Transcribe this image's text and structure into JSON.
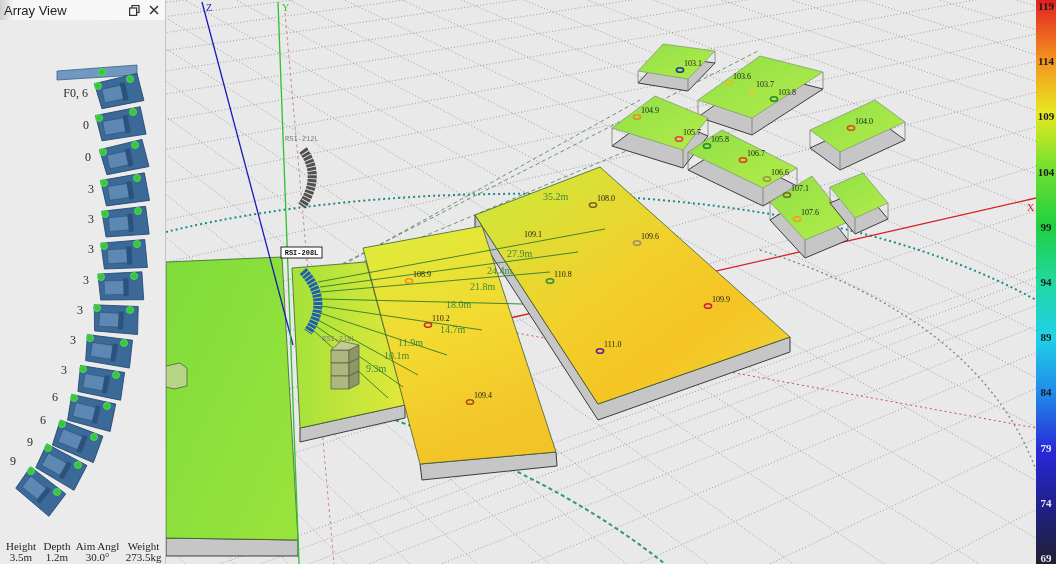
{
  "array_view": {
    "title": "Array View",
    "splay_angles": [
      "F0, 6",
      "0",
      "0",
      "3",
      "3",
      "3",
      "3",
      "3",
      "3",
      "3",
      "6",
      "6",
      "9",
      "9"
    ],
    "specs": [
      {
        "label": "Height",
        "value": "3.5m"
      },
      {
        "label": "Depth",
        "value": "1.2m"
      },
      {
        "label": "Aim Angl",
        "value": "30.0°"
      },
      {
        "label": "Weight",
        "value": "273.5kg"
      }
    ]
  },
  "viewport": {
    "axes": [
      "Z",
      "Y",
      "X"
    ],
    "arrays": [
      {
        "kind": "line_array",
        "label": "RSI-208L",
        "selected": true
      },
      {
        "kind": "line_array",
        "label": "RSI-212L",
        "selected": false
      },
      {
        "kind": "subwoofer",
        "label": "RSI-218L",
        "selected": false
      }
    ],
    "distances": [
      "35.2m",
      "27.9m",
      "24.4m",
      "21.8m",
      "18.0m",
      "14.7m",
      "11.9m",
      "10.1m",
      "9.3m"
    ],
    "listeners": [
      {
        "reading": "103.1",
        "color": "#1d3f8f"
      },
      {
        "reading": "103.6",
        "color": "#d8c030"
      },
      {
        "reading": "103.7",
        "color": "#d8d040"
      },
      {
        "reading": "103.8",
        "color": "#2a8a30"
      },
      {
        "reading": "104.9",
        "color": "#e89020"
      },
      {
        "reading": "105.7",
        "color": "#e04050"
      },
      {
        "reading": "104.0",
        "color": "#e04a10"
      },
      {
        "reading": "105.8",
        "color": "#2a8a30"
      },
      {
        "reading": "106.7",
        "color": "#e04010"
      },
      {
        "reading": "106.6",
        "color": "#9a9a40"
      },
      {
        "reading": "107.1",
        "color": "#707020"
      },
      {
        "reading": "107.6",
        "color": "#f0a020"
      },
      {
        "reading": "108.0",
        "color": "#806020"
      },
      {
        "reading": "109.1",
        "color": "#e8d840"
      },
      {
        "reading": "109.6",
        "color": "#a09060"
      },
      {
        "reading": "108.9",
        "color": "#f09020"
      },
      {
        "reading": "110.8",
        "color": "#3a8a30"
      },
      {
        "reading": "109.9",
        "color": "#d02040"
      },
      {
        "reading": "110.2",
        "color": "#d03020"
      },
      {
        "reading": "111.0",
        "color": "#602090"
      },
      {
        "reading": "109.4",
        "color": "#b05010"
      }
    ]
  },
  "color_scale": {
    "ticks": [
      "119",
      "114",
      "109",
      "104",
      "99",
      "94",
      "89",
      "84",
      "79",
      "74",
      "69"
    ]
  }
}
